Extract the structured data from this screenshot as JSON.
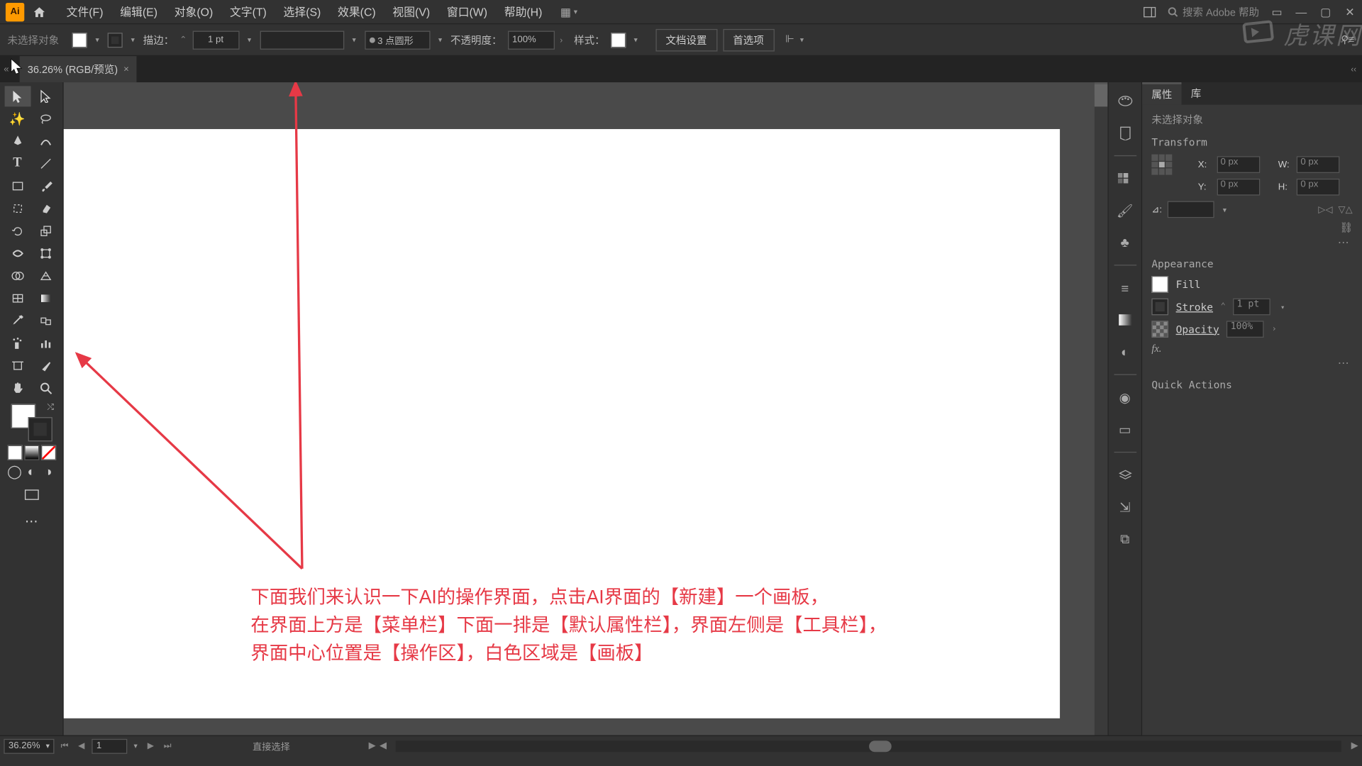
{
  "app_icon": "Ai",
  "menubar": {
    "items": [
      "文件(F)",
      "编辑(E)",
      "对象(O)",
      "文字(T)",
      "选择(S)",
      "效果(C)",
      "视图(V)",
      "窗口(W)",
      "帮助(H)"
    ],
    "search_placeholder": "搜索 Adobe 帮助"
  },
  "watermark": "虎课网",
  "options": {
    "no_selection": "未选择对象",
    "stroke_label": "描边：",
    "stroke_weight": "1 pt",
    "dash_label": "3 点圆形",
    "opacity_label": "不透明度：",
    "opacity_value": "100%",
    "style_label": "样式：",
    "doc_setup": "文档设置",
    "preferences": "首选项"
  },
  "doc_tab": {
    "title": "36.26% (RGB/预览)",
    "close": "×"
  },
  "annotation": {
    "line1": "下面我们来认识一下AI的操作界面，点击AI界面的【新建】一个画板，",
    "line2": "在界面上方是【菜单栏】下面一排是【默认属性栏】，界面左侧是【工具栏】，",
    "line3": "界面中心位置是【操作区】，白色区域是【画板】"
  },
  "panel": {
    "tabs": [
      "属性",
      "库"
    ],
    "no_sel": "未选择对象",
    "transform": "Transform",
    "X": "X:",
    "Y": "Y:",
    "W": "W:",
    "H": "H:",
    "xval": "0 px",
    "yval": "0 px",
    "wval": "0 px",
    "hval": "0 px",
    "angle": "⊿:",
    "appearance": "Appearance",
    "fill": "Fill",
    "stroke": "Stroke",
    "stroke_val": "1 pt",
    "opacity": "Opacity",
    "opacity_val": "100%",
    "fx": "fx.",
    "quick_actions": "Quick Actions"
  },
  "statusbar": {
    "zoom": "36.26%",
    "artboard": "1",
    "tool_hint": "直接选择"
  }
}
